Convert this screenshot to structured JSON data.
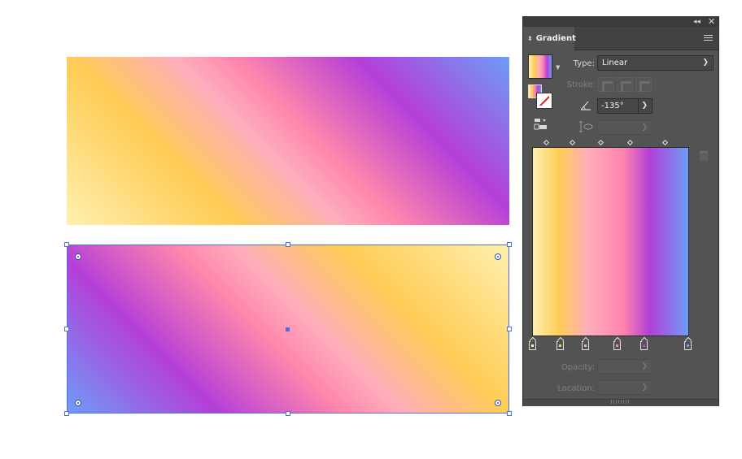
{
  "panel": {
    "tab_label": "Gradient",
    "type_label": "Type:",
    "type_value": "Linear",
    "stroke_label": "Stroke:",
    "angle_value": "-135°",
    "opacity_label": "Opacity:",
    "location_label": "Location:"
  },
  "icons": {
    "collapse": "double-chevron-left-icon",
    "close": "close-icon",
    "menu": "hamburger-menu-icon",
    "angle": "angle-icon",
    "aspect": "aspect-ratio-icon",
    "delete": "trash-icon",
    "gradient_tool": "gradient-tool-icon"
  },
  "gradient": {
    "stops": [
      "#fff0b0",
      "#ffcc55",
      "#ffaebc",
      "#ff85ad",
      "#b43fd8",
      "#6e9df8"
    ],
    "accent_selection": "#4a6fe0"
  }
}
